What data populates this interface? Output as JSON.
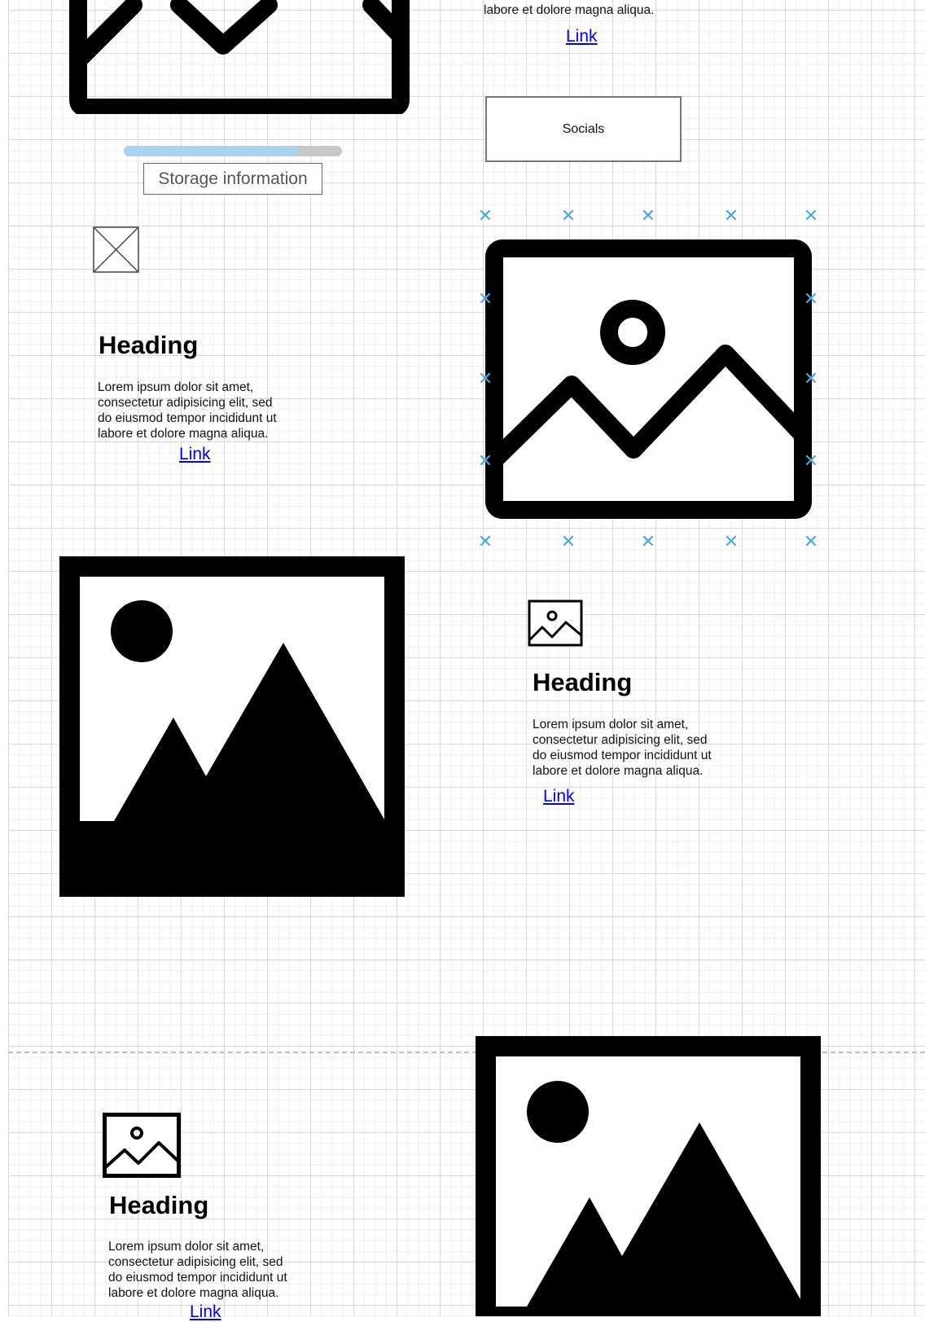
{
  "top_right_block": {
    "lorem_tail": "labore et dolore magna aliqua.",
    "link": "Link"
  },
  "socials": {
    "label": "Socials"
  },
  "storage": {
    "label": "Storage information",
    "progress_fraction": 0.8,
    "fill_color": "#a8d4f0",
    "track_color": "#c8c8c8"
  },
  "card_left_1": {
    "heading": "Heading",
    "body": "Lorem ipsum dolor sit amet,\nconsectetur adipisicing elit, sed\ndo eiusmod tempor incididunt ut\nlabore et dolore magna aliqua.",
    "link": "Link"
  },
  "card_right_1": {
    "heading": "Heading",
    "body": "Lorem ipsum dolor sit amet,\nconsectetur adipisicing elit, sed\ndo eiusmod tempor incididunt ut\nlabore et dolore magna aliqua.",
    "link": "Link"
  },
  "card_left_2": {
    "heading": "Heading",
    "body": "Lorem ipsum dolor sit amet,\nconsectetur adipisicing elit, sed\ndo eiusmod tempor incididunt ut\nlabore et dolore magna aliqua.",
    "link": "Link"
  },
  "icons": {
    "large_image_outline": "image-outline-icon",
    "large_image_filled": "image-filled-icon",
    "small_image": "image-icon",
    "placeholder": "image-placeholder-icon",
    "selection_handle": "selection-handle-icon"
  },
  "colors": {
    "grid_major": "#d9d9d9",
    "grid_minor": "#efefef",
    "selection_handle": "#53a6dc",
    "link": "#0000ee"
  }
}
